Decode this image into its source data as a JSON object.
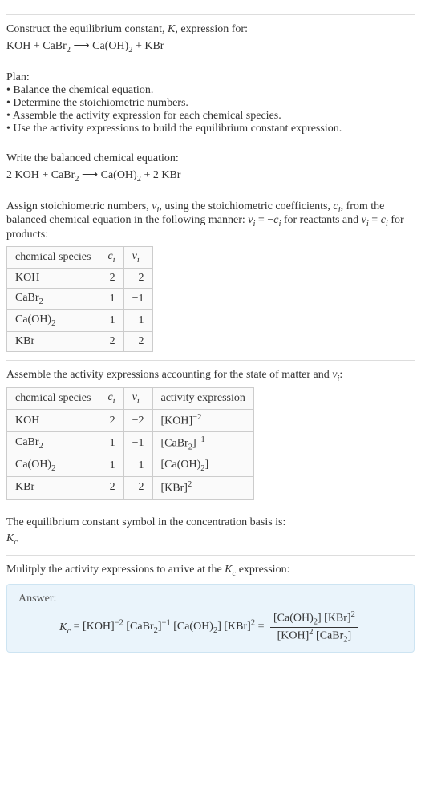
{
  "intro": {
    "line1": "Construct the equilibrium constant, K, expression for:",
    "equation": "KOH + CaBr₂ ⟶ Ca(OH)₂ + KBr"
  },
  "plan": {
    "heading": "Plan:",
    "items": [
      "• Balance the chemical equation.",
      "• Determine the stoichiometric numbers.",
      "• Assemble the activity expression for each chemical species.",
      "• Use the activity expressions to build the equilibrium constant expression."
    ]
  },
  "balanced": {
    "heading": "Write the balanced chemical equation:",
    "equation": "2 KOH + CaBr₂ ⟶ Ca(OH)₂ + 2 KBr"
  },
  "stoich": {
    "text_a": "Assign stoichiometric numbers, ",
    "text_b": ", using the stoichiometric coefficients, ",
    "text_c": ", from the balanced chemical equation in the following manner: ",
    "text_d": " for reactants and ",
    "text_e": " for products:",
    "nu": "νᵢ",
    "ci": "cᵢ",
    "rel_reactants": "νᵢ = −cᵢ",
    "rel_products": "νᵢ = cᵢ",
    "headers": [
      "chemical species",
      "cᵢ",
      "νᵢ"
    ],
    "rows": [
      {
        "sp": "KOH",
        "c": "2",
        "v": "−2"
      },
      {
        "sp": "CaBr₂",
        "c": "1",
        "v": "−1"
      },
      {
        "sp": "Ca(OH)₂",
        "c": "1",
        "v": "1"
      },
      {
        "sp": "KBr",
        "c": "2",
        "v": "2"
      }
    ]
  },
  "activity": {
    "heading_a": "Assemble the activity expressions accounting for the state of matter and ",
    "heading_b": ":",
    "nu": "νᵢ",
    "headers": [
      "chemical species",
      "cᵢ",
      "νᵢ",
      "activity expression"
    ],
    "rows": [
      {
        "sp": "KOH",
        "c": "2",
        "v": "−2",
        "a": "[KOH]⁻²"
      },
      {
        "sp": "CaBr₂",
        "c": "1",
        "v": "−1",
        "a": "[CaBr₂]⁻¹"
      },
      {
        "sp": "Ca(OH)₂",
        "c": "1",
        "v": "1",
        "a": "[Ca(OH)₂]"
      },
      {
        "sp": "KBr",
        "c": "2",
        "v": "2",
        "a": "[KBr]²"
      }
    ]
  },
  "symbol": {
    "heading": "The equilibrium constant symbol in the concentration basis is:",
    "kc": "K",
    "kc_sub": "c"
  },
  "multiply": {
    "heading_a": "Mulitply the activity expressions to arrive at the ",
    "heading_b": " expression:",
    "kc": "K",
    "kc_sub": "c"
  },
  "answer": {
    "label": "Answer:",
    "lhs": "Kc = [KOH]⁻² [CaBr₂]⁻¹ [Ca(OH)₂] [KBr]² =",
    "frac_num": "[Ca(OH)₂] [KBr]²",
    "frac_den": "[KOH]² [CaBr₂]"
  }
}
